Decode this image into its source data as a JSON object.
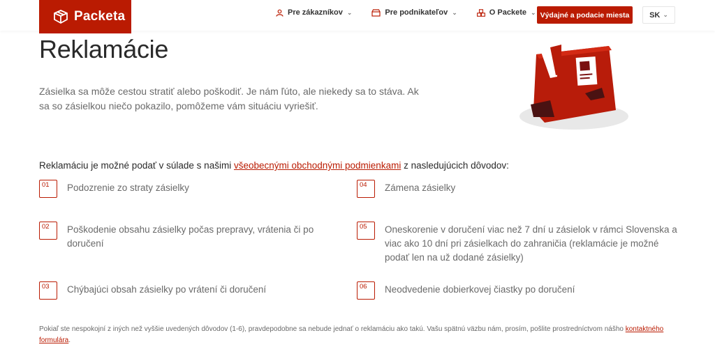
{
  "header": {
    "logo_text": "Packeta",
    "nav": [
      {
        "label": "Pre zákazníkov"
      },
      {
        "label": "Pre podnikateľov"
      },
      {
        "label": "O Packete"
      }
    ],
    "cta_label": "Výdajné a podacie miesta",
    "language": "SK"
  },
  "hero": {
    "title": "Reklamácie",
    "intro": "Zásielka sa môže cestou stratiť alebo poškodiť. Je nám ľúto, ale niekedy sa to stáva. Ak sa so zásielkou niečo pokazilo, pomôžeme vám situáciu vyriešiť."
  },
  "reasons": {
    "lead_before": "Reklamáciu je možné podať v súlade s našimi ",
    "lead_link": "všeobecnými obchodnými podmienkami",
    "lead_after": " z nasledujúcich dôvodov:",
    "items": [
      {
        "num": "01",
        "text": "Podozrenie zo straty zásielky"
      },
      {
        "num": "02",
        "text": "Poškodenie obsahu zásielky počas prepravy, vrátenia či po doručení"
      },
      {
        "num": "03",
        "text": "Chýbajúci obsah zásielky po vrátení či doručení"
      },
      {
        "num": "04",
        "text": "Zámena zásielky"
      },
      {
        "num": "05",
        "text": "Oneskorenie v doručení viac než 7 dní u zásielok v rámci Slovenska a viac ako 10 dní pri zásielkach do zahraničia (reklamácie je možné podať len na už dodané zásielky)"
      },
      {
        "num": "06",
        "text": "Neodvedenie dobierkovej čiastky po doručení"
      }
    ]
  },
  "footnote": {
    "text": "Pokiaľ ste nespokojní z iných než vyššie uvedených dôvodov (1-6), pravdepodobne sa nebude jednať o reklamáciu ako takú. Vašu spätnú väzbu nám, prosím, pošlite prostredníctvom nášho ",
    "link": "kontaktného formulára",
    "end": "."
  },
  "colors": {
    "brand": "#ba1b02"
  },
  "icons": [
    "packeta-logo-icon",
    "user-icon",
    "shop-icon",
    "boxes-icon",
    "chevron-down-icon",
    "damaged-parcel-illustration"
  ]
}
